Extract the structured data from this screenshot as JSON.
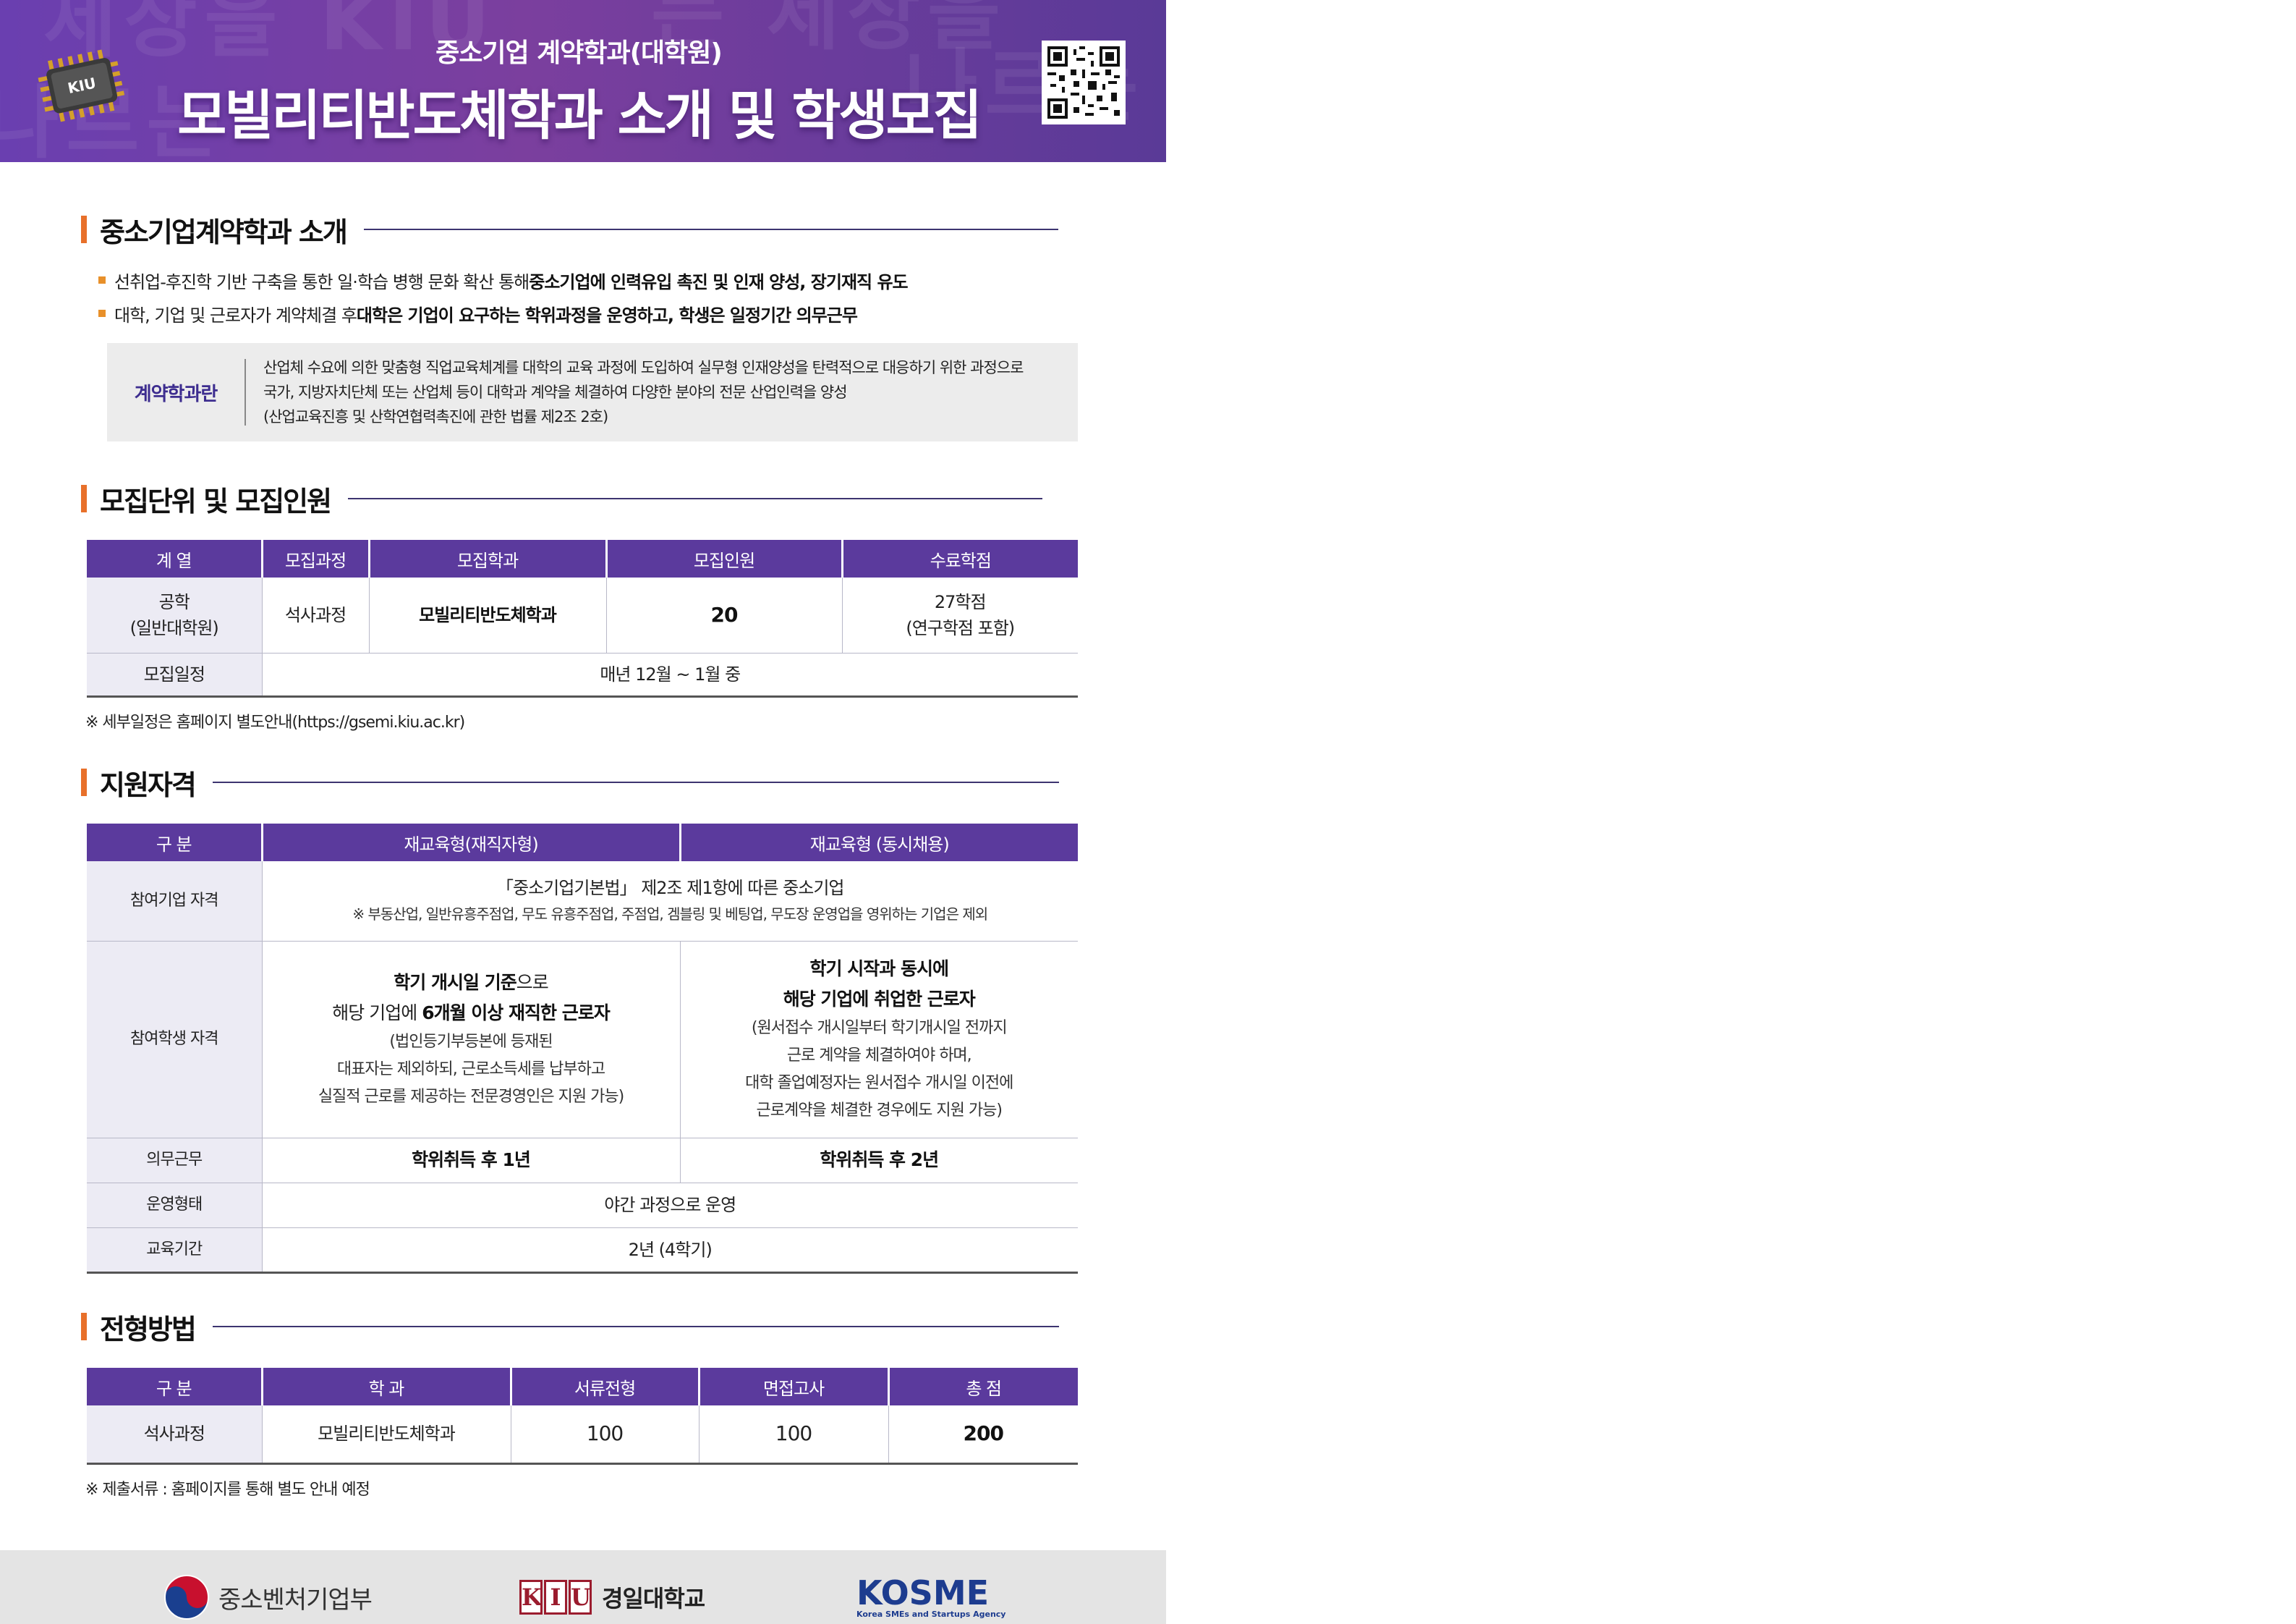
{
  "header": {
    "subtitle": "중소기업 계약학과(대학원)",
    "title": "모빌리티반도체학과 소개 및 학생모집",
    "chip_label": "KIU"
  },
  "intro": {
    "heading": "중소기업계약학과 소개",
    "bullets": [
      {
        "normal": "선취업-후진학 기반 구축을 통한 일·학습 병행 문화 확산 통해 ",
        "bold": "중소기업에 인력유입 촉진 및 인재 양성, 장기재직 유도"
      },
      {
        "normal": "대학, 기업 및 근로자가 계약체결 후 ",
        "bold": "대학은 기업이 요구하는 학위과정을 운영하고, 학생은 일정기간 의무근무"
      }
    ],
    "definition": {
      "label": "계약학과란",
      "lines": [
        "산업체 수요에 의한 맞춤형 직업교육체계를 대학의 교육 과정에 도입하여 실무형 인재양성을 탄력적으로 대응하기 위한 과정으로",
        "국가, 지방자치단체 또는 산업체 등이 대학과 계약을 체결하여 다양한 분야의 전문 산업인력을 양성",
        "(산업교육진흥 및 산학연협력촉진에 관한 법률 제2조 2호)"
      ]
    }
  },
  "recruit": {
    "heading": "모집단위 및 모집인원",
    "headers": [
      "계 열",
      "모집과정",
      "모집학과",
      "모집인원",
      "수료학점"
    ],
    "row": {
      "field_line1": "공학",
      "field_line2": "(일반대학원)",
      "course": "석사과정",
      "department": "모빌리티반도체학과",
      "count": "20",
      "credits_line1": "27학점",
      "credits_line2": "(연구학점 포함)"
    },
    "schedule_label": "모집일정",
    "schedule_value": "매년 12월 ~ 1월 중",
    "note": "※ 세부일정은 홈페이지 별도안내(https://gsemi.kiu.ac.kr)"
  },
  "qualification": {
    "heading": "지원자격",
    "headers": [
      "구 분",
      "재교육형(재직자형)",
      "재교육형 (동시채용)"
    ],
    "company_label": "참여기업 자격",
    "company_main": "「중소기업기본법」 제2조 제1항에 따른 중소기업",
    "company_sub": "※ 부동산업, 일반유흥주점업, 무도 유흥주점업, 주점업, 겜블링 및 베팅업, 무도장 운영업을 영위하는 기업은 제외",
    "student_label": "참여학생 자격",
    "col1": {
      "l1_bold": "학기 개시일 기준",
      "l1_normal": "으로",
      "l2_normal": "해당 기업에 ",
      "l2_bold": "6개월 이상 재직한 근로자",
      "l3": "(법인등기부등본에 등재된",
      "l4": "대표자는 제외하되, 근로소득세를 납부하고",
      "l5": "실질적 근로를 제공하는 전문경영인은 지원 가능)"
    },
    "col2": {
      "l1": "학기 시작과 동시에",
      "l2": "해당 기업에 취업한 근로자",
      "l3": "(원서접수 개시일부터 학기개시일 전까지",
      "l4": "근로 계약을 체결하여야 하며,",
      "l5": "대학 졸업예정자는 원서접수 개시일 이전에",
      "l6": "근로계약을 체결한 경우에도 지원 가능)"
    },
    "duty_label": "의무근무",
    "duty_col1": "학위취득 후 1년",
    "duty_col2": "학위취득 후 2년",
    "operation_label": "운영형태",
    "operation_value": "야간 과정으로 운영",
    "period_label": "교육기간",
    "period_value": "2년 (4학기)"
  },
  "selection": {
    "heading": "전형방법",
    "headers": [
      "구 분",
      "학 과",
      "서류전형",
      "면접고사",
      "총 점"
    ],
    "row": [
      "석사과정",
      "모빌리티반도체학과",
      "100",
      "100",
      "200"
    ],
    "note": "※ 제출서류 : 홈페이지를 통해 별도 안내 예정"
  },
  "footer": {
    "ministry": "중소벤처기업부",
    "kiu_letters": [
      "K",
      "I",
      "U"
    ],
    "university": "경일대학교",
    "kosme": "KOSME",
    "kosme_sub": "Korea SMEs and Startups Agency"
  },
  "colors": {
    "header_purple": "#6a3fb0",
    "table_header": "#5b3a9d",
    "accent_orange": "#e8702a",
    "row_label_bg": "#ecebf4"
  }
}
